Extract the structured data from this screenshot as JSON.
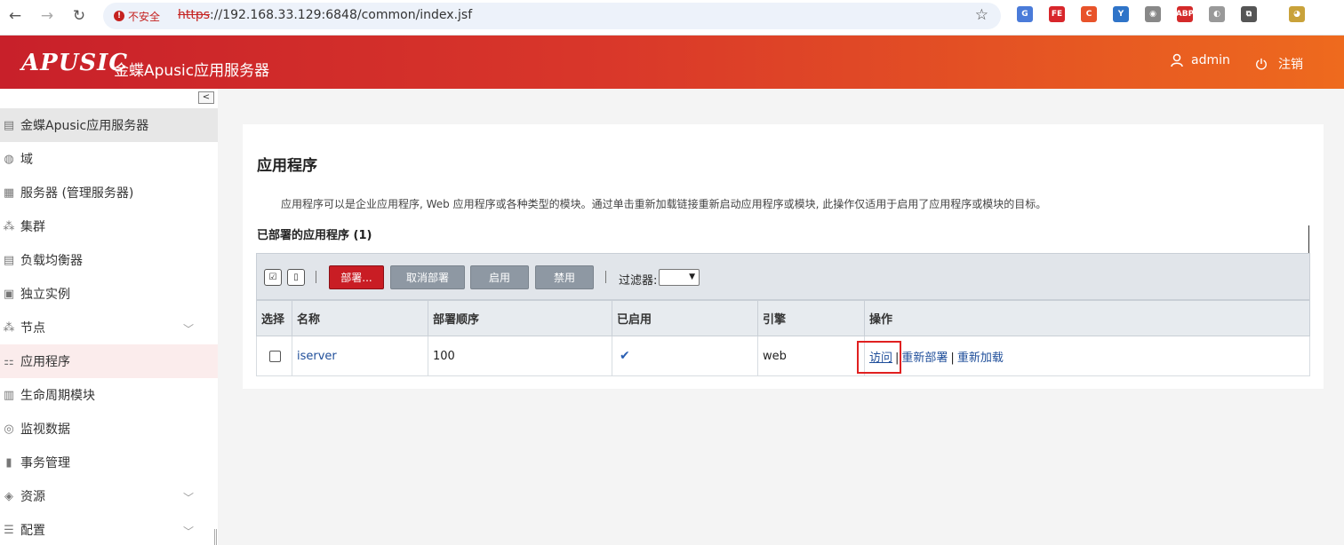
{
  "browser": {
    "insecure_label": "不安全",
    "url_protocol": "https",
    "url_rest": "://192.168.33.129:6848/common/index.jsf",
    "extensions": [
      {
        "name": "translate-ext-icon",
        "color": "#4a7bd9",
        "label": "G"
      },
      {
        "name": "fe-ext-icon",
        "color": "#d8262b",
        "label": "FE"
      },
      {
        "name": "c-ext-icon",
        "color": "#e8532a",
        "label": "C"
      },
      {
        "name": "y-ext-icon",
        "color": "#2f74c8",
        "label": "Y"
      },
      {
        "name": "camera-ext-icon",
        "color": "#888888",
        "label": "◉"
      },
      {
        "name": "abp-ext-icon",
        "color": "#d42a2a",
        "label": "ABP"
      },
      {
        "name": "puzzle-ext-icon",
        "color": "#999999",
        "label": "◐"
      },
      {
        "name": "extensions-icon",
        "color": "#555555",
        "label": "⧉"
      },
      {
        "name": "profile-avatar-icon",
        "color": "#c9a23a",
        "label": "◕"
      }
    ]
  },
  "header": {
    "logo": "APUSIC",
    "title": "金蝶Apusic应用服务器",
    "user": "admin",
    "logout": "注销"
  },
  "sidebar": {
    "items": [
      {
        "label": "金蝶Apusic应用服务器",
        "icon": "▤",
        "expandable": false
      },
      {
        "label": "域",
        "icon": "◍",
        "expandable": false
      },
      {
        "label": "服务器 (管理服务器)",
        "icon": "▦",
        "expandable": false
      },
      {
        "label": "集群",
        "icon": "⁂",
        "expandable": false
      },
      {
        "label": "负载均衡器",
        "icon": "▤",
        "expandable": false
      },
      {
        "label": "独立实例",
        "icon": "▣",
        "expandable": false
      },
      {
        "label": "节点",
        "icon": "⁂",
        "expandable": true
      },
      {
        "label": "应用程序",
        "icon": "⚏",
        "expandable": false
      },
      {
        "label": "生命周期模块",
        "icon": "▥",
        "expandable": false
      },
      {
        "label": "监视数据",
        "icon": "◎",
        "expandable": false
      },
      {
        "label": "事务管理",
        "icon": "▮",
        "expandable": false
      },
      {
        "label": "资源",
        "icon": "◈",
        "expandable": true
      },
      {
        "label": "配置",
        "icon": "☰",
        "expandable": true
      }
    ]
  },
  "main": {
    "title": "应用程序",
    "description": "应用程序可以是企业应用程序, Web 应用程序或各种类型的模块。通过单击重新加载链接重新启动应用程序或模块, 此操作仅适用于启用了应用程序或模块的目标。",
    "table_title": "已部署的应用程序 (1)",
    "toolbar": {
      "deploy": "部署...",
      "undeploy": "取消部署",
      "enable": "启用",
      "disable": "禁用",
      "filter_label": "过滤器:"
    },
    "columns": [
      "选择",
      "名称",
      "部署顺序",
      "已启用",
      "引擎",
      "操作"
    ],
    "rows": [
      {
        "name": "iserver",
        "order": "100",
        "enabled": "✔",
        "engine": "web",
        "actions": [
          "访问",
          "重新部署",
          "重新加载"
        ]
      }
    ]
  }
}
